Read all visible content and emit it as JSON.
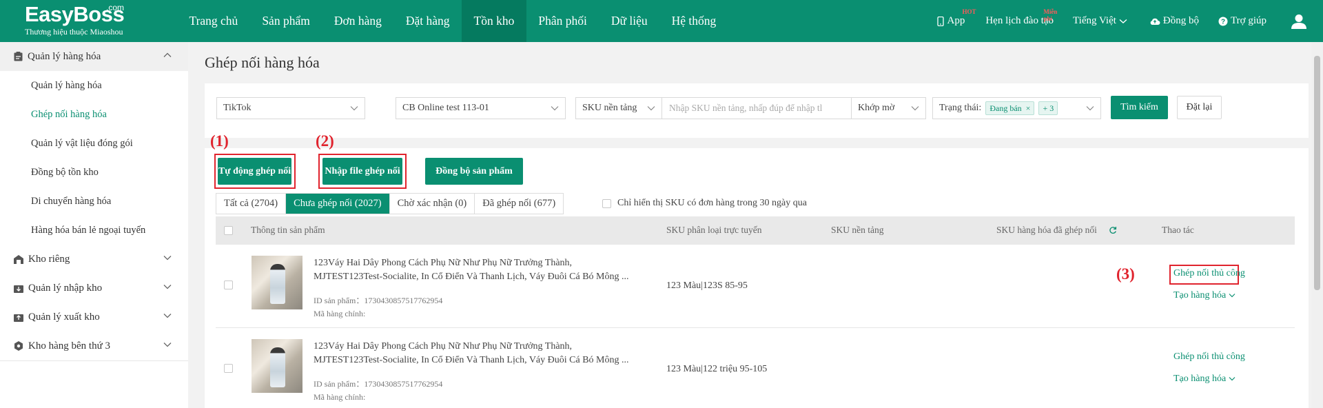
{
  "logo": {
    "name": "EasyBoss",
    "com": ".com",
    "tagline": "Thương hiệu thuộc Miaoshou"
  },
  "nav": {
    "items": [
      "Trang chủ",
      "Sản phẩm",
      "Đơn hàng",
      "Đặt hàng",
      "Tồn kho",
      "Phân phối",
      "Dữ liệu",
      "Hệ thống"
    ],
    "active": "Tồn kho",
    "right": {
      "app": "App",
      "app_badge": "HOT",
      "training": "Hẹn lịch đào tạo",
      "training_badge": "Miễn phí",
      "language": "Tiếng Việt",
      "sync": "Đồng bộ",
      "help": "Trợ giúp"
    }
  },
  "sidebar": {
    "groups": [
      {
        "label": "Quản lý hàng hóa",
        "icon": "clipboard-icon",
        "open": true,
        "items": [
          "Quản lý hàng hóa",
          "Ghép nối hàng hóa",
          "Quản lý vật liệu đóng gói",
          "Đồng bộ tồn kho",
          "Di chuyển hàng hóa",
          "Hàng hóa bán lẻ ngoại tuyến"
        ],
        "active": "Ghép nối hàng hóa"
      },
      {
        "label": "Kho riêng",
        "icon": "warehouse-icon"
      },
      {
        "label": "Quản lý nhập kho",
        "icon": "inbound-icon"
      },
      {
        "label": "Quản lý xuất kho",
        "icon": "outbound-icon"
      },
      {
        "label": "Kho hàng bên thứ 3",
        "icon": "third-party-icon"
      }
    ]
  },
  "page": {
    "title": "Ghép nối hàng hóa"
  },
  "filters": {
    "platform": "TikTok",
    "store": "CB Online test 113-01",
    "sku_type": "SKU nền tảng",
    "sku_placeholder": "Nhập SKU nền tảng, nhấp đúp để nhập tl",
    "match_mode": "Khớp mờ",
    "status_label": "Trạng thái:",
    "status_tag": "Đang bán",
    "status_more": "+ 3",
    "search_btn": "Tìm kiếm",
    "reset_btn": "Đặt lại"
  },
  "actions": {
    "auto_match": "Tự động ghép nối",
    "import_file": "Nhập file ghép nối",
    "sync_products": "Đồng bộ sản phẩm"
  },
  "annotations": {
    "a1": "(1)",
    "a2": "(2)",
    "a3": "(3)"
  },
  "tabs": [
    "Tất cả (2704)",
    "Chưa ghép nối (2027)",
    "Chờ xác nhận (0)",
    "Đã ghép nối (677)"
  ],
  "active_tab": "Chưa ghép nối (2027)",
  "only_sku_label": "Chỉ hiển thị SKU có đơn hàng trong 30 ngày qua",
  "table": {
    "headers": {
      "product": "Thông tin sản phẩm",
      "online_sku": "SKU phân loại trực tuyến",
      "platform_sku": "SKU nền tảng",
      "matched_sku": "SKU hàng hóa đã ghép nối",
      "actions": "Thao tác"
    },
    "rows": [
      {
        "name_line1": "123Váy Hai Dây Phong Cách Phụ Nữ Như Phụ Nữ Trưởng Thành,",
        "name_line2": "MJTEST123Test-Socialite, In Cổ Điển Và Thanh Lịch, Váy Đuôi Cá Bó Mông ...",
        "id": "ID sản phẩm：1730430857517762954",
        "main_code": "Mã hàng chính:",
        "online_sku": "123 Màu|123S 85-95",
        "manual_match": "Ghép nối thủ công",
        "create_goods": "Tạo hàng hóa"
      },
      {
        "name_line1": "123Váy Hai Dây Phong Cách Phụ Nữ Như Phụ Nữ Trưởng Thành,",
        "name_line2": "MJTEST123Test-Socialite, In Cổ Điển Và Thanh Lịch, Váy Đuôi Cá Bó Mông ...",
        "id": "ID sản phẩm：1730430857517762954",
        "main_code": "Mã hàng chính:",
        "online_sku": "123 Màu|122 triệu 95-105",
        "manual_match": "Ghép nối thủ công",
        "create_goods": "Tạo hàng hóa"
      }
    ]
  },
  "colors": {
    "brand": "#0a8f71",
    "annotation": "#e0232d"
  }
}
